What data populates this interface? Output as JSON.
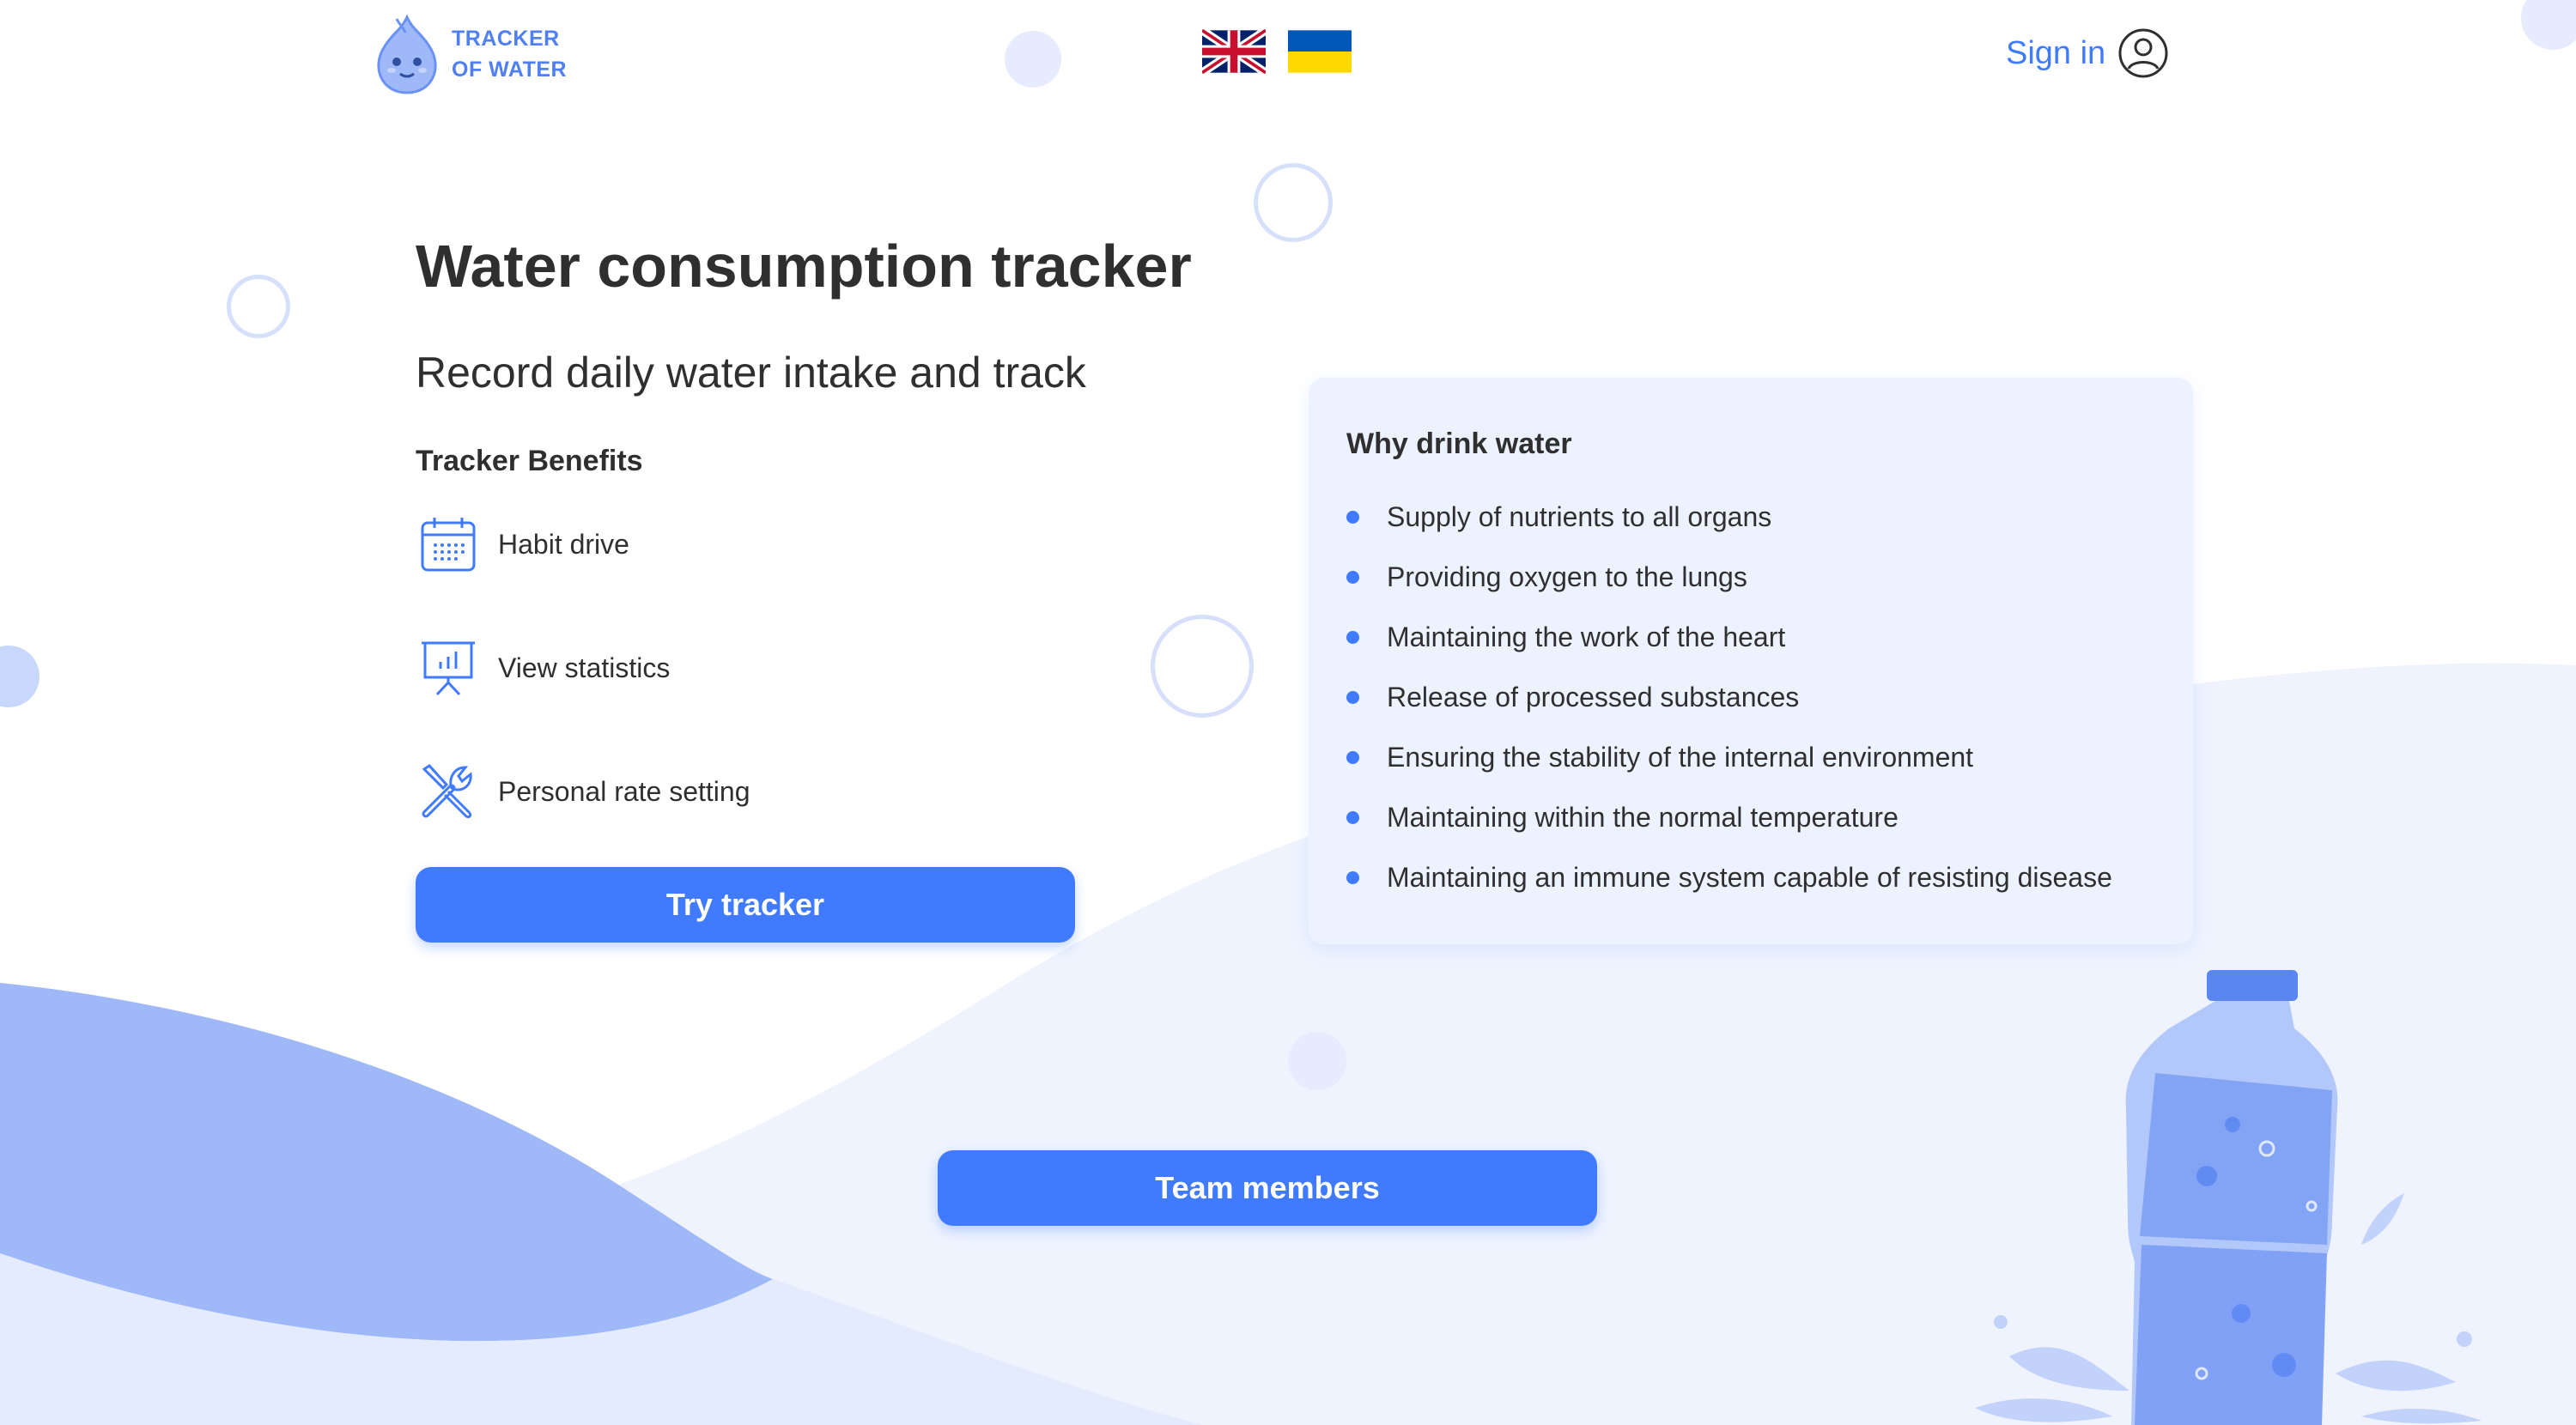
{
  "header": {
    "logo_line1": "TRACKER",
    "logo_line2": "OF WATER",
    "languages": [
      {
        "name": "English",
        "icon": "uk-flag-icon"
      },
      {
        "name": "Ukrainian",
        "icon": "ukraine-flag-icon"
      }
    ],
    "signin_label": "Sign in",
    "signin_icon": "user-icon"
  },
  "hero": {
    "title": "Water consumption tracker",
    "subtitle": "Record daily water intake and track",
    "benefits_heading": "Tracker Benefits",
    "benefits": [
      {
        "label": "Habit drive",
        "icon": "calendar-icon"
      },
      {
        "label": "View statistics",
        "icon": "presentation-chart-icon"
      },
      {
        "label": "Personal rate setting",
        "icon": "tools-icon"
      }
    ],
    "try_button": "Try tracker"
  },
  "why_card": {
    "title": "Why drink water",
    "items": [
      "Supply of nutrients to all organs",
      "Providing oxygen to the lungs",
      "Maintaining the work of the heart",
      "Release of processed substances",
      "Ensuring the stability of the internal environment",
      "Maintaining within the normal temperature",
      "Maintaining an immune system capable of resisting disease"
    ]
  },
  "footer": {
    "team_button": "Team members"
  },
  "colors": {
    "accent": "#407BFF",
    "text": "#2F2F2F",
    "card_bg": "#ECF2FF",
    "wave_light": "#EEF3FE",
    "wave_dark": "#9FB8F8"
  }
}
